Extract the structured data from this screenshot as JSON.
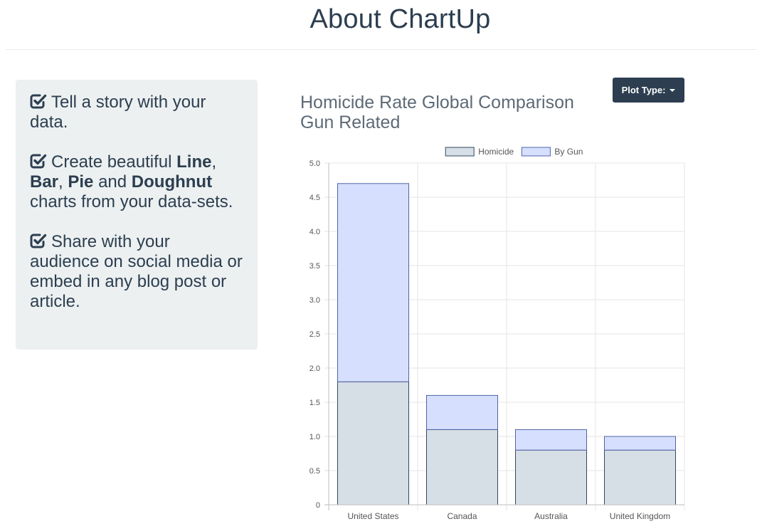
{
  "header": {
    "title": "About ChartUp"
  },
  "features": [
    {
      "parts": [
        {
          "text": "Tell a story with your data.",
          "bold": false
        }
      ]
    },
    {
      "parts": [
        {
          "text": "Create beautiful ",
          "bold": false
        },
        {
          "text": "Line",
          "bold": true
        },
        {
          "text": ", ",
          "bold": false
        },
        {
          "text": "Bar",
          "bold": true
        },
        {
          "text": ", ",
          "bold": false
        },
        {
          "text": "Pie",
          "bold": true
        },
        {
          "text": " and ",
          "bold": false
        },
        {
          "text": "Doughnut",
          "bold": true
        },
        {
          "text": " charts from your data-sets.",
          "bold": false
        }
      ]
    },
    {
      "parts": [
        {
          "text": "Share with your audience on social media or embed in any blog post or article.",
          "bold": false
        }
      ]
    }
  ],
  "icons": {
    "feature_check": "check-square-icon",
    "dropdown": "caret-down-icon"
  },
  "toolbar": {
    "plot_type_label": "Plot Type:"
  },
  "colors": {
    "text_dark": "#2c3e50",
    "panel_bg": "#ecf0f1",
    "homicide_fill": "#d6dee6",
    "homicide_border": "#34495e",
    "gun_fill": "#d6dffd",
    "gun_border": "#4f64a8"
  },
  "chart_data": {
    "type": "bar",
    "stacked": true,
    "title": "Homicide Rate Global Comparison Gun Related",
    "categories": [
      "United States",
      "Canada",
      "Australia",
      "United Kingdom"
    ],
    "series": [
      {
        "name": "Homicide",
        "values": [
          1.8,
          1.1,
          0.8,
          0.8
        ]
      },
      {
        "name": "By Gun",
        "values": [
          2.9,
          0.5,
          0.3,
          0.2
        ]
      }
    ],
    "ylim": [
      0,
      5.0
    ],
    "yticks": [
      "0",
      "0.5",
      "1.0",
      "1.5",
      "2.0",
      "2.5",
      "3.0",
      "3.5",
      "4.0",
      "4.5",
      "5.0"
    ],
    "legend": "top",
    "grid": true
  }
}
